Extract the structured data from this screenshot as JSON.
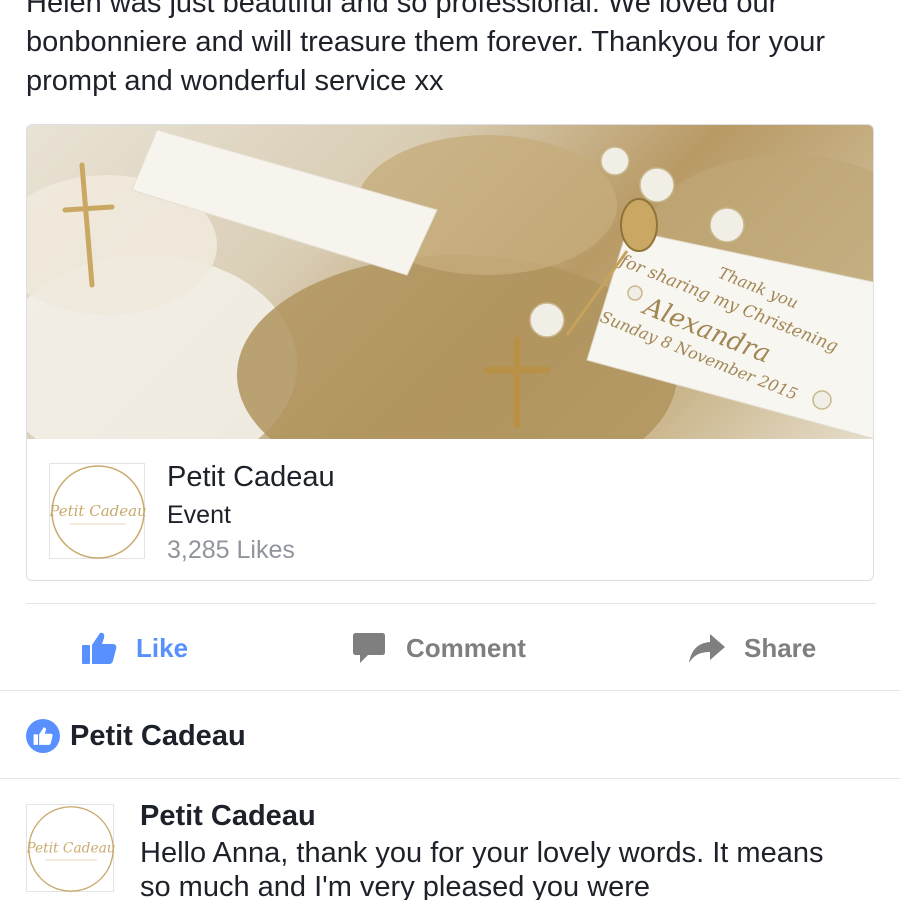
{
  "post": {
    "text": "Helen was just beautiful and so professional. We loved our bonbonniere and will treasure them forever. Thankyou for your prompt and wonderful service xx"
  },
  "card": {
    "photo_tag_lines": [
      "Thank you",
      "for sharing my Christening",
      "Alexandra",
      "Sunday 8 November 2015"
    ],
    "page_name": "Petit Cadeau",
    "category": "Event",
    "likes": "3,285 Likes",
    "logo_text": "Petit Cadeau"
  },
  "actions": {
    "like": "Like",
    "comment": "Comment",
    "share": "Share",
    "colors": {
      "like": "#5890ff",
      "inactive": "#7f7f7f"
    }
  },
  "liked_by": {
    "name": "Petit Cadeau",
    "icon": "thumbs-up-icon"
  },
  "comment": {
    "author": "Petit Cadeau",
    "text": "Hello Anna, thank you for your lovely words. It means so much and I'm very pleased you were",
    "logo_text": "Petit Cadeau"
  }
}
